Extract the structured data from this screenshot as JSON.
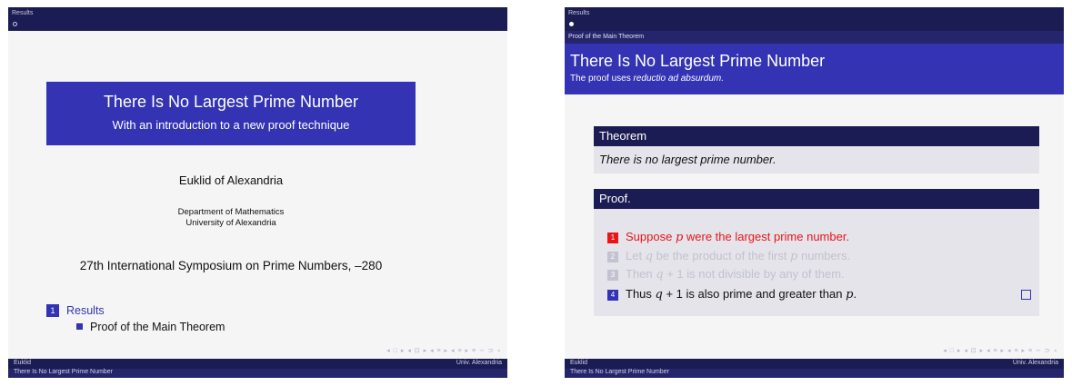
{
  "slide1": {
    "nav_section": "Results",
    "title": "There Is No Largest Prime Number",
    "subtitle": "With an introduction to a new proof technique",
    "author": "Euklid of Alexandria",
    "department": "Department of Mathematics",
    "university": "University of Alexandria",
    "date": "27th International Symposium on Prime Numbers, –280",
    "toc": {
      "section_number": "1",
      "section_label": "Results",
      "subsection_label": "Proof of the Main Theorem"
    },
    "footer_author": "Euklid",
    "footer_institute": "Univ. Alexandria",
    "footer_title": "There Is No Largest Prime Number"
  },
  "slide2": {
    "nav_section": "Results",
    "subsection_bar": "Proof of the Main Theorem",
    "frame_title": "There Is No Largest Prime Number",
    "frame_subtitle_prefix": "The proof uses ",
    "frame_subtitle_emph": "reductio ad absurdum.",
    "theorem_header": "Theorem",
    "theorem_body": "There is no largest prime number.",
    "proof_header": "Proof.",
    "steps": [
      {
        "num": "1",
        "pre": "Suppose ",
        "var": "p",
        "post": " were the largest prime number."
      },
      {
        "num": "2",
        "pre": "Let ",
        "var": "q",
        "mid": " be the product of the first ",
        "var2": "p",
        "post": " numbers."
      },
      {
        "num": "3",
        "pre": "Then ",
        "var": "q",
        "post": " + 1 is not divisible by any of them."
      },
      {
        "num": "4",
        "pre": "Thus ",
        "var": "q",
        "mid": " + 1 is also prime and greater than ",
        "var2": "p",
        "post": "."
      }
    ],
    "footer_author": "Euklid",
    "footer_institute": "Univ. Alexandria",
    "footer_title": "There Is No Largest Prime Number"
  },
  "nav_symbols": "◂ □ ▸ ◂ ⊡ ▸ ◂ ≡ ▸ ◂ ≡ ▸ ≡ ∽ ⊃ ∘",
  "colors": {
    "accent": "#3333b3",
    "dark_bar": "#1c1c54",
    "alert": "#e8161a"
  }
}
